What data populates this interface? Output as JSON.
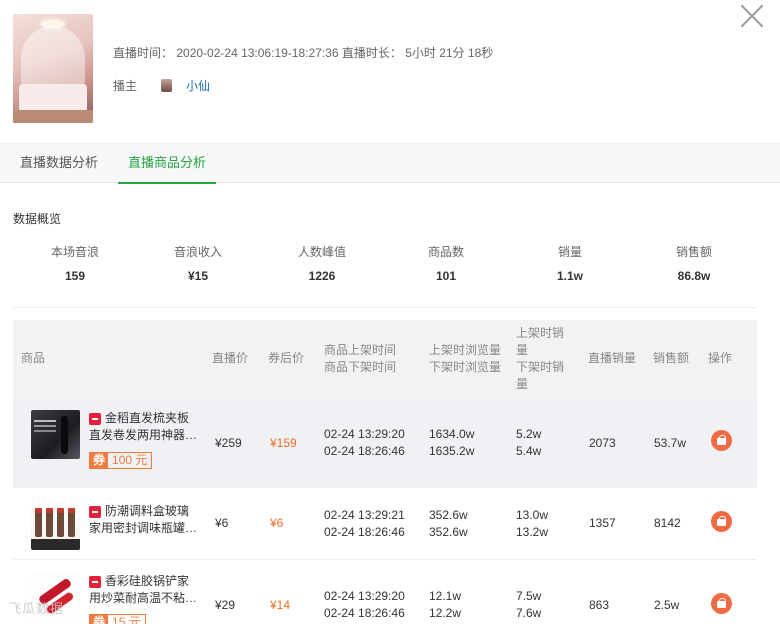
{
  "header": {
    "live_time_label": "直播时间：",
    "live_time_value": "2020-02-24 13:06:19-18:27:36",
    "duration_label": "直播时长：",
    "duration_value": "5小时 21分 18秒",
    "host_label": "播主",
    "host_name": "小仙"
  },
  "tabs": [
    {
      "label": "直播数据分析",
      "active": false
    },
    {
      "label": "直播商品分析",
      "active": true
    }
  ],
  "overview": {
    "title": "数据概览",
    "stats": [
      {
        "label": "本场音浪",
        "value": "159"
      },
      {
        "label": "音浪收入",
        "value": "¥15"
      },
      {
        "label": "人数峰值",
        "value": "1226"
      },
      {
        "label": "商品数",
        "value": "101"
      },
      {
        "label": "销量",
        "value": "1.1w"
      },
      {
        "label": "销售额",
        "value": "86.8w"
      }
    ]
  },
  "table": {
    "headers": {
      "product": "商品",
      "live_price": "直播价",
      "coupon_price": "券后价",
      "listed_time_1": "商品上架时间",
      "listed_time_2": "商品下架时间",
      "views_1": "上架时浏览量",
      "views_2": "下架时浏览量",
      "sales_1a": "上架时销",
      "sales_1b": "量",
      "sales_2a": "下架时销",
      "sales_2b": "量",
      "live_sales": "直播销量",
      "revenue": "销售额",
      "action": "操作"
    },
    "rows": [
      {
        "name_line1": "金稻直发梳夹板",
        "name_line2": "直发卷发两用神器…",
        "coupon_tag": "券",
        "coupon_value": "100 元",
        "live_price": "¥259",
        "coupon_price": "¥159",
        "on_time": "02-24 13:29:20",
        "off_time": "02-24 18:26:46",
        "on_views": "1634.0w",
        "off_views": "1635.2w",
        "on_sales": "5.2w",
        "off_sales": "5.4w",
        "live_sales": "2073",
        "revenue": "53.7w"
      },
      {
        "name_line1": "防潮调料盒玻璃",
        "name_line2": "家用密封调味瓶罐…",
        "live_price": "¥6",
        "coupon_price": "¥6",
        "on_time": "02-24 13:29:21",
        "off_time": "02-24 18:26:46",
        "on_views": "352.6w",
        "off_views": "352.6w",
        "on_sales": "13.0w",
        "off_sales": "13.2w",
        "live_sales": "1357",
        "revenue": "8142"
      },
      {
        "name_line1": "香彩硅胶锅铲家",
        "name_line2": "用炒菜耐高温不粘…",
        "coupon_tag": "券",
        "coupon_value": "15 元",
        "live_price": "¥29",
        "coupon_price": "¥14",
        "on_time": "02-24 13:29:20",
        "off_time": "02-24 18:26:46",
        "on_views": "12.1w",
        "off_views": "12.2w",
        "on_sales": "7.5w",
        "off_sales": "7.6w",
        "live_sales": "863",
        "revenue": "2.5w"
      }
    ]
  },
  "watermark": "飞瓜数据",
  "colors": {
    "accent_green": "#24a33e",
    "price_orange": "#ef6b1f",
    "link_blue": "#1a6fb6",
    "action_orange": "#ef6b43"
  }
}
